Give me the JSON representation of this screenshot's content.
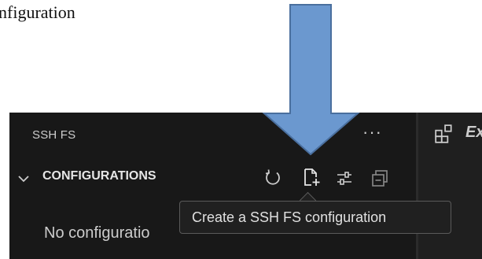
{
  "document": {
    "partial_text": "nfiguration"
  },
  "panel": {
    "title": "SSH FS",
    "more_label": "···",
    "section": {
      "label": "CONFIGURATIONS",
      "actions": [
        {
          "name": "refresh",
          "icon": "refresh-icon"
        },
        {
          "name": "create-configuration",
          "icon": "new-file-icon"
        },
        {
          "name": "settings",
          "icon": "settings-sliders-icon"
        },
        {
          "name": "collapse-all",
          "icon": "collapse-all-icon"
        }
      ]
    },
    "empty_message": "No configuratio"
  },
  "right_pane": {
    "label": "Ex",
    "icon": "extensions-icon"
  },
  "tooltip": {
    "text": "Create a SSH FS configuration"
  },
  "annotation": {
    "arrow_color": "#6b98cf",
    "arrow_stroke": "#4a6f9e"
  },
  "colors": {
    "panel_bg": "#181818",
    "text": "#cccccc",
    "tooltip_bg": "#202020"
  }
}
